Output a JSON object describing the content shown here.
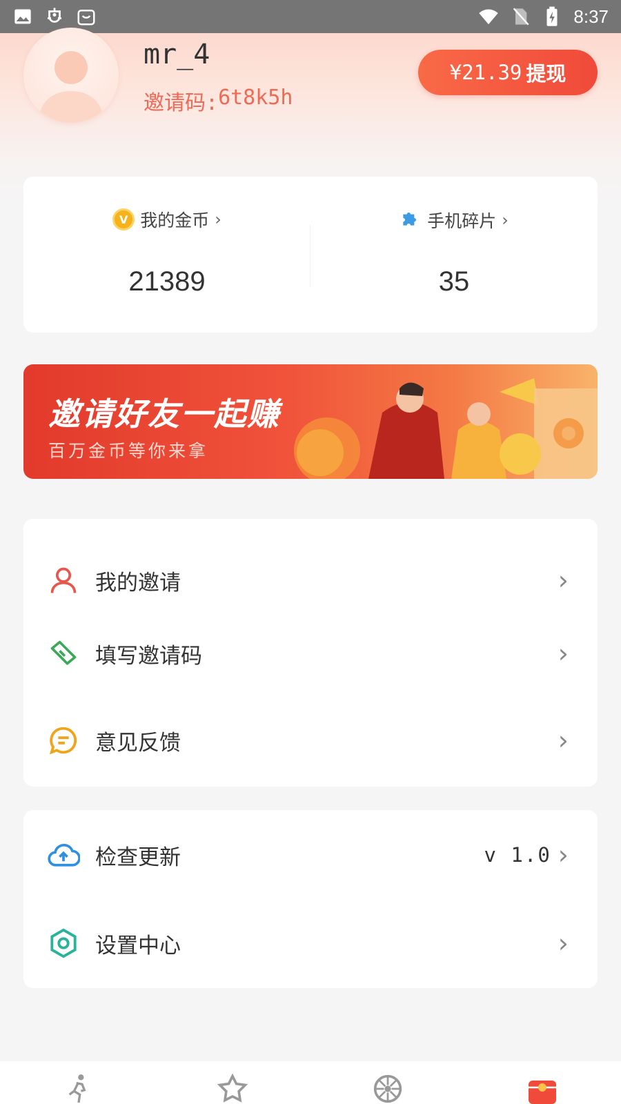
{
  "status_bar": {
    "time": "8:37",
    "left_icons": [
      "image-icon",
      "bug-app-icon",
      "shopping-bag-icon"
    ],
    "right_icons": [
      "wifi-icon",
      "no-sim-icon",
      "battery-charging-icon"
    ]
  },
  "profile": {
    "username": "mr_4",
    "invite_label": "邀请码:",
    "invite_code": "6t8k5h",
    "withdraw_amount": "¥21.39",
    "withdraw_label": "提现"
  },
  "stats": {
    "coins_label": "我的金币",
    "coins_value": "21389",
    "fragments_label": "手机碎片",
    "fragments_value": "35"
  },
  "banner": {
    "title": "邀请好友一起赚",
    "subtitle": "百万金币等你来拿"
  },
  "menu_group_1": [
    {
      "label": "我的邀请",
      "icon": "user-icon",
      "color": "#e8554a"
    },
    {
      "label": "填写邀请码",
      "icon": "ticket-icon",
      "color": "#3aa957"
    },
    {
      "label": "意见反馈",
      "icon": "chat-icon",
      "color": "#f0a41c"
    }
  ],
  "menu_group_2": [
    {
      "label": "检查更新",
      "icon": "cloud-upload-icon",
      "color": "#2f8fe0",
      "value": "v 1.0"
    },
    {
      "label": "设置中心",
      "icon": "settings-icon",
      "color": "#29b39a"
    }
  ],
  "bottom_nav": [
    "run-icon",
    "star-badge-icon",
    "wheel-icon",
    "gift-box-icon"
  ],
  "colors": {
    "accent": "#f04a3a",
    "invite_text": "#ee6a55"
  }
}
